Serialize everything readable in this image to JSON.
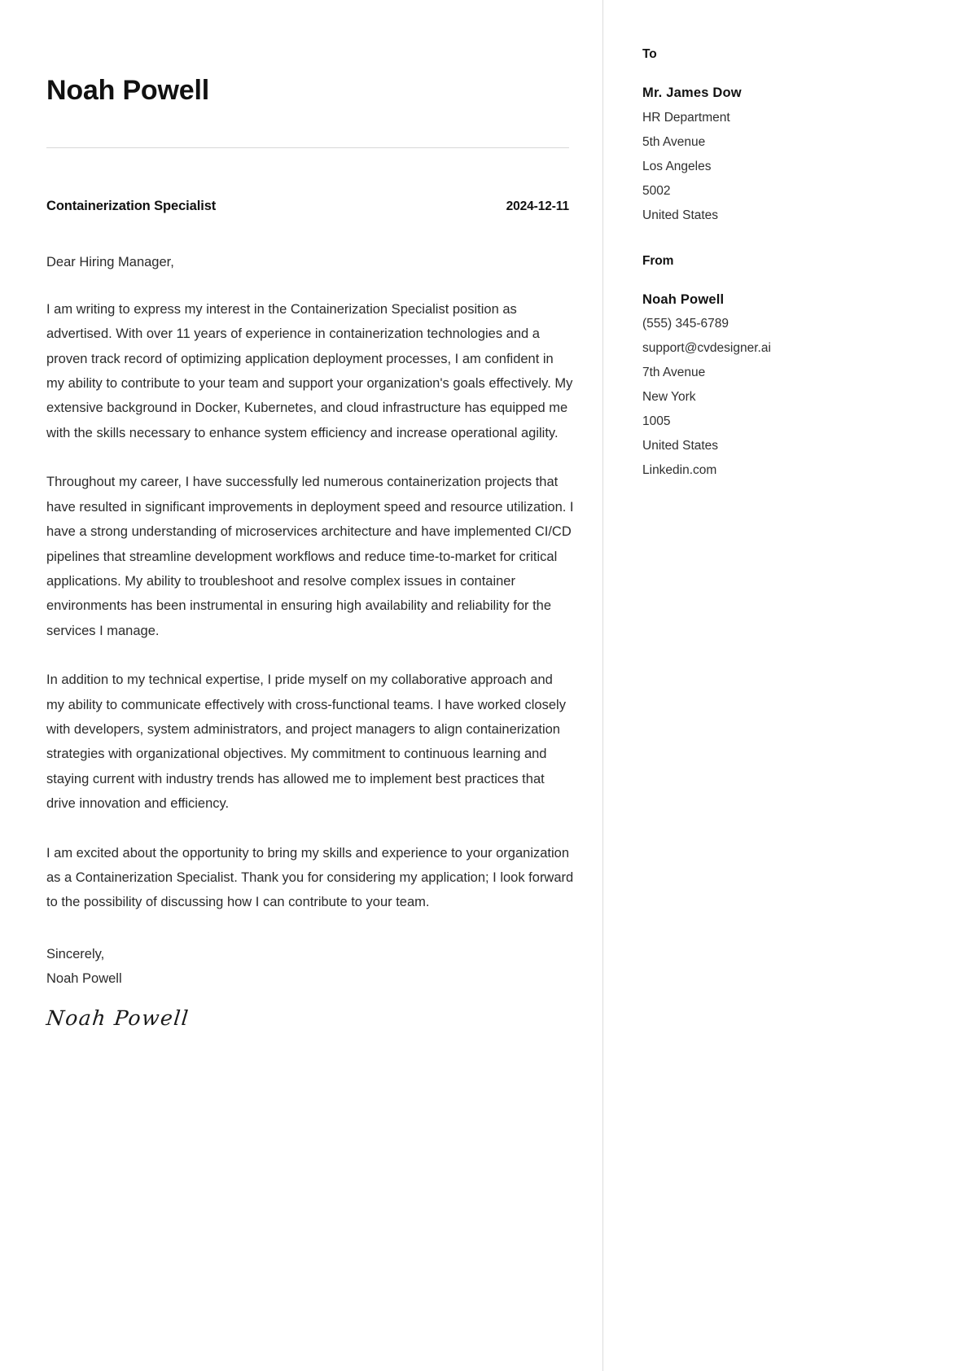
{
  "letter": {
    "name": "Noah Powell",
    "subject": "Containerization Specialist",
    "date": "2024-12-11",
    "salutation": "Dear Hiring Manager,",
    "paragraphs": [
      "I am writing to express my interest in the Containerization Specialist position as advertised. With over 11 years of experience in containerization technologies and a proven track record of optimizing application deployment processes, I am confident in my ability to contribute to your team and support your organization's goals effectively. My extensive background in Docker, Kubernetes, and cloud infrastructure has equipped me with the skills necessary to enhance system efficiency and increase operational agility.",
      "Throughout my career, I have successfully led numerous containerization projects that have resulted in significant improvements in deployment speed and resource utilization. I have a strong understanding of microservices architecture and have implemented CI/CD pipelines that streamline development workflows and reduce time-to-market for critical applications. My ability to troubleshoot and resolve complex issues in container environments has been instrumental in ensuring high availability and reliability for the services I manage.",
      "In addition to my technical expertise, I pride myself on my collaborative approach and my ability to communicate effectively with cross-functional teams. I have worked closely with developers, system administrators, and project managers to align containerization strategies with organizational objectives. My commitment to continuous learning and staying current with industry trends has allowed me to implement best practices that drive innovation and efficiency.",
      "I am excited about the opportunity to bring my skills and experience to your organization as a Containerization Specialist. Thank you for considering my application; I look forward to the possibility of discussing how I can contribute to your team."
    ],
    "closing_word": "Sincerely,",
    "closing_name": "Noah Powell",
    "signature": "Noah Powell"
  },
  "sidebar": {
    "to": {
      "heading": "To",
      "person": "Mr. James Dow",
      "lines": [
        "HR Department",
        "5th Avenue",
        "Los Angeles",
        "5002",
        "United States"
      ]
    },
    "from": {
      "heading": "From",
      "person": "Noah Powell",
      "lines": [
        "(555) 345-6789",
        "support@cvdesigner.ai",
        "7th Avenue",
        "New York",
        "1005",
        "United States",
        "Linkedin.com"
      ]
    }
  },
  "colors": {
    "text": "#2b2b2b",
    "heading": "#111111",
    "rule": "#d8d8d8",
    "divider": "#dcdcdc",
    "background": "#ffffff"
  }
}
